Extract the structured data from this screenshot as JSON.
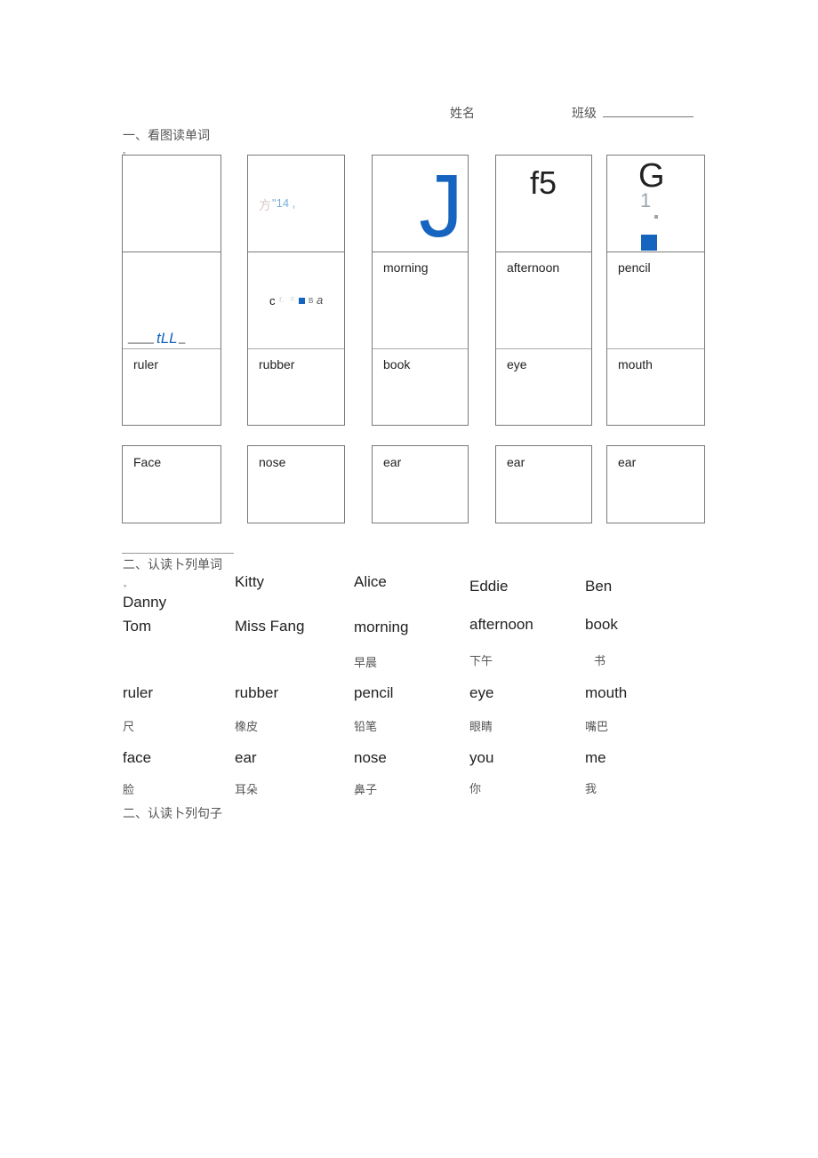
{
  "header": {
    "name_label": "姓名",
    "class_label": "班级",
    "class_blank": "________________"
  },
  "section1": {
    "title": "一、看图读单词",
    "dot": "。",
    "row1_artifacts": {
      "col2_text_a": "方",
      "col2_text_b": "\"14 ,",
      "col3_letter": "J",
      "col4_text": "f5",
      "col5_letter": "G",
      "col5_sub": "1"
    },
    "row2_artifacts": {
      "col1_text": "tLL",
      "col1_underline_left": "____",
      "col1_underline_right": "_",
      "col2_c": "c",
      "col2_r": "r.",
      "col2_f": "F",
      "col2_b": "B",
      "col2_a": "a"
    },
    "row2_labels": [
      "",
      "",
      "morning",
      "afternoon",
      "pencil"
    ],
    "row3_labels": [
      "ruler",
      "rubber",
      "book",
      "eye",
      "mouth"
    ],
    "row4_labels": [
      "Face",
      "nose",
      "ear",
      "ear",
      "ear"
    ],
    "accent_color": "#1565c0"
  },
  "section2": {
    "title": "二、认读卜列单词",
    "dot": "。",
    "names_row": [
      "Danny",
      "Kitty",
      "Alice",
      "Eddie",
      "Ben"
    ],
    "words": [
      {
        "en": [
          "Tom",
          "Miss Fang",
          "morning",
          "afternoon",
          "book"
        ],
        "zh": [
          "",
          "",
          "早晨",
          "下午",
          "书"
        ]
      },
      {
        "en": [
          "ruler",
          "rubber",
          "pencil",
          "eye",
          "mouth"
        ],
        "zh": [
          "尺",
          "橡皮",
          "铅笔",
          "眼睛",
          "嘴巴"
        ]
      },
      {
        "en": [
          "face",
          "ear",
          "nose",
          "you",
          "me"
        ],
        "zh": [
          "脸",
          "耳朵",
          "鼻子",
          "你",
          "我"
        ]
      }
    ]
  },
  "section3": {
    "title": "二、认读卜列句子"
  }
}
